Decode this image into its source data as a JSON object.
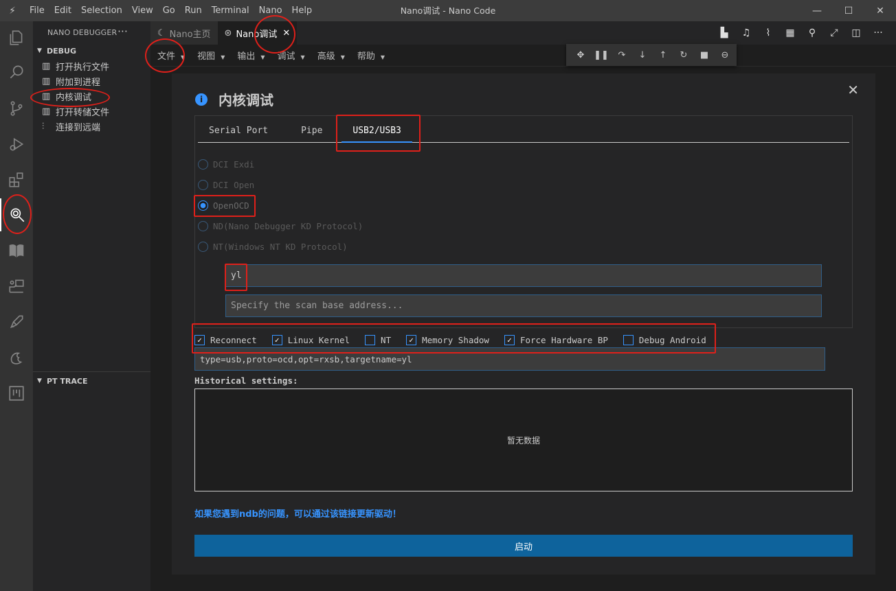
{
  "window": {
    "title": "Nano调试 - Nano Code",
    "menu": [
      "File",
      "Edit",
      "Selection",
      "View",
      "Go",
      "Run",
      "Terminal",
      "Nano",
      "Help"
    ]
  },
  "sidebar": {
    "header": "NANO DEBUGGER",
    "more": "···",
    "debug_section": "DEBUG",
    "items": [
      {
        "label": "打开执行文件",
        "icon": "panel-icon"
      },
      {
        "label": "附加到进程",
        "icon": "panel-icon"
      },
      {
        "label": "内核调试",
        "icon": "panel-icon"
      },
      {
        "label": "打开转储文件",
        "icon": "panel-icon"
      },
      {
        "label": "连接到远端",
        "icon": "sliders-icon"
      }
    ],
    "pt_section": "PT TRACE"
  },
  "tabs": [
    {
      "label": "Nano主页",
      "active": false
    },
    {
      "label": "Nano调试",
      "active": true,
      "close": "✕"
    }
  ],
  "editor_menu": [
    "文件",
    "视图",
    "输出",
    "调试",
    "高级",
    "帮助"
  ],
  "dialog": {
    "title": "内核调试",
    "close": "✕",
    "connection_tabs": [
      "Serial Port",
      "Pipe",
      "USB2/USB3"
    ],
    "active_tab": "USB2/USB3",
    "protocols": [
      {
        "label": "DCI Exdi",
        "selected": false
      },
      {
        "label": "DCI Open",
        "selected": false
      },
      {
        "label": "OpenOCD",
        "selected": true
      },
      {
        "label": "ND(Nano Debugger KD Protocol)",
        "selected": false
      },
      {
        "label": "NT(Windows NT KD Protocol)",
        "selected": false
      }
    ],
    "target_name_value": "yl",
    "scan_base_placeholder": "Specify the scan base address...",
    "options": [
      {
        "label": "Reconnect",
        "checked": true
      },
      {
        "label": "Linux Kernel",
        "checked": true
      },
      {
        "label": "NT",
        "checked": false
      },
      {
        "label": "Memory Shadow",
        "checked": true
      },
      {
        "label": "Force Hardware BP",
        "checked": true
      },
      {
        "label": "Debug Android",
        "checked": false
      }
    ],
    "command_line": "type=usb,proto=ocd,opt=rxsb,targetname=yl",
    "history_label": "Historical settings:",
    "history_empty": "暂无数据",
    "driver_link": "如果您遇到ndb的问题，可以通过该链接更新驱动！",
    "start_button": "启动"
  },
  "colors": {
    "accent": "#3794ff",
    "button": "#0e639c",
    "annotation": "#e0201a"
  }
}
